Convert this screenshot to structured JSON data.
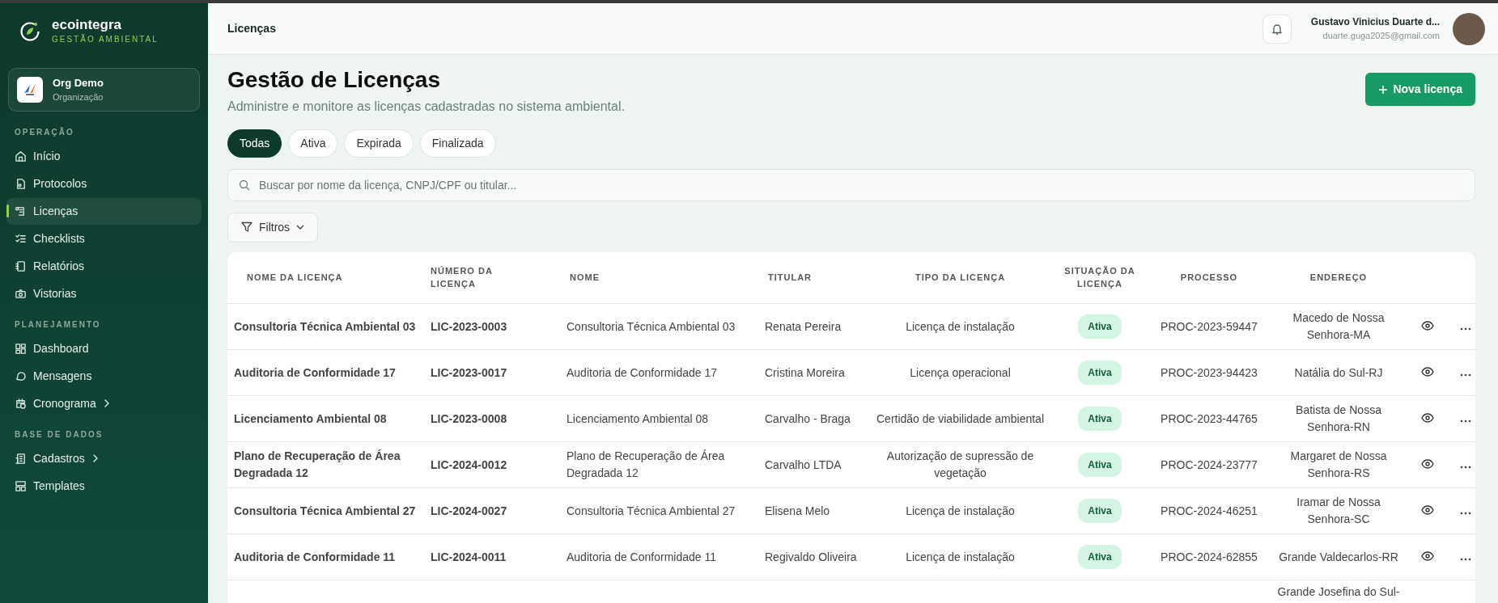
{
  "sidebar": {
    "brand": {
      "name": "ecointegra",
      "tagline": "GESTÃO AMBIENTAL"
    },
    "org": {
      "name": "Org Demo",
      "subtitle": "Organização"
    },
    "sections": [
      {
        "title": "OPERAÇÃO",
        "items": [
          {
            "label": "Início",
            "selected": false,
            "expandable": false
          },
          {
            "label": "Protocolos",
            "selected": false,
            "expandable": false
          },
          {
            "label": "Licenças",
            "selected": true,
            "expandable": false
          },
          {
            "label": "Checklists",
            "selected": false,
            "expandable": false
          },
          {
            "label": "Relatórios",
            "selected": false,
            "expandable": false
          },
          {
            "label": "Vistorias",
            "selected": false,
            "expandable": false
          }
        ]
      },
      {
        "title": "PLANEJAMENTO",
        "items": [
          {
            "label": "Dashboard",
            "selected": false,
            "expandable": false
          },
          {
            "label": "Mensagens",
            "selected": false,
            "expandable": false
          },
          {
            "label": "Cronograma",
            "selected": false,
            "expandable": true
          }
        ]
      },
      {
        "title": "BASE DE DADOS",
        "items": [
          {
            "label": "Cadastros",
            "selected": false,
            "expandable": true
          },
          {
            "label": "Templates",
            "selected": false,
            "expandable": false
          }
        ]
      }
    ]
  },
  "topbar": {
    "breadcrumb": "Licenças",
    "user": {
      "name": "Gustavo Vinicius Duarte d...",
      "email": "duarte.guga2025@gmail.com"
    }
  },
  "page": {
    "title": "Gestão de Licenças",
    "subtitle": "Administre e monitore as licenças cadastradas no sistema ambiental.",
    "primary_action": "Nova licença"
  },
  "filter_tabs": [
    {
      "label": "Todas",
      "selected": true
    },
    {
      "label": "Ativa",
      "selected": false
    },
    {
      "label": "Expirada",
      "selected": false
    },
    {
      "label": "Finalizada",
      "selected": false
    }
  ],
  "search": {
    "placeholder": "Buscar por nome da licença, CNPJ/CPF ou titular..."
  },
  "filters_button": "Filtros",
  "table": {
    "columns": [
      "NOME DA LICENÇA",
      "NÚMERO DA LICENÇA",
      "NOME",
      "TITULAR",
      "TIPO DA LICENÇA",
      "SITUAÇÃO DA LICENÇA",
      "PROCESSO",
      "ENDEREÇO"
    ],
    "rows": [
      {
        "nome_licenca": "Consultoria Técnica Ambiental 03",
        "numero": "LIC-2023-0003",
        "nome": "Consultoria Técnica Ambiental 03",
        "titular": "Renata Pereira",
        "tipo": "Licença de instalação",
        "situacao": "Ativa",
        "processo": "PROC-2023-59447",
        "endereco": "Macedo de Nossa Senhora-MA"
      },
      {
        "nome_licenca": "Auditoria de Conformidade 17",
        "numero": "LIC-2023-0017",
        "nome": "Auditoria de Conformidade 17",
        "titular": "Cristina Moreira",
        "tipo": "Licença operacional",
        "situacao": "Ativa",
        "processo": "PROC-2023-94423",
        "endereco": "Natália do Sul-RJ"
      },
      {
        "nome_licenca": "Licenciamento Ambiental 08",
        "numero": "LIC-2023-0008",
        "nome": "Licenciamento Ambiental 08",
        "titular": "Carvalho - Braga",
        "tipo": "Certidão de viabilidade ambiental",
        "situacao": "Ativa",
        "processo": "PROC-2023-44765",
        "endereco": "Batista de Nossa Senhora-RN"
      },
      {
        "nome_licenca": "Plano de Recuperação de Área Degradada 12",
        "numero": "LIC-2024-0012",
        "nome": "Plano de Recuperação de Área Degradada 12",
        "titular": "Carvalho LTDA",
        "tipo": "Autorização de supressão de vegetação",
        "situacao": "Ativa",
        "processo": "PROC-2024-23777",
        "endereco": "Margaret de Nossa Senhora-RS"
      },
      {
        "nome_licenca": "Consultoria Técnica Ambiental 27",
        "numero": "LIC-2024-0027",
        "nome": "Consultoria Técnica Ambiental 27",
        "titular": "Elisena Melo",
        "tipo": "Licença de instalação",
        "situacao": "Ativa",
        "processo": "PROC-2024-46251",
        "endereco": "Iramar de Nossa Senhora-SC"
      },
      {
        "nome_licenca": "Auditoria de Conformidade 11",
        "numero": "LIC-2024-0011",
        "nome": "Auditoria de Conformidade 11",
        "titular": "Regivaldo Oliveira",
        "tipo": "Licença de instalação",
        "situacao": "Ativa",
        "processo": "PROC-2024-62855",
        "endereco": "Grande Valdecarlos-RR"
      },
      {
        "endereco": "Grande Josefina do Sul-"
      }
    ]
  }
}
